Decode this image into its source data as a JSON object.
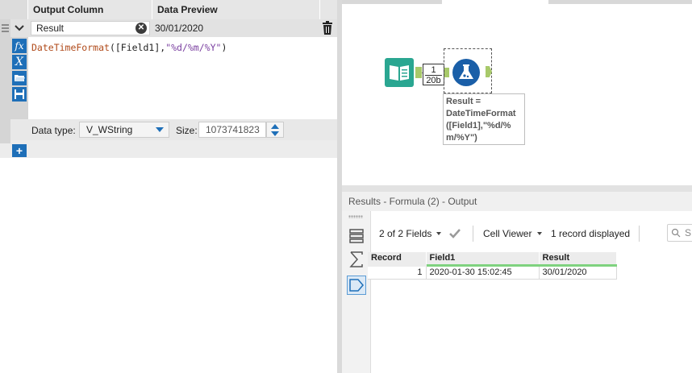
{
  "formula_panel": {
    "header": {
      "col_output": "Output Column",
      "col_preview": "Data Preview"
    },
    "row": {
      "output_value": "Result",
      "preview_value": "30/01/2020",
      "expression_fn": "DateTimeFormat",
      "expression_open": "([Field1],",
      "expression_fmt": "\"%d/%m/%Y\"",
      "expression_close": ")"
    },
    "datatype_label": "Data type:",
    "datatype_value": "V_WString",
    "size_label": "Size:",
    "size_value": "1073741823",
    "add_label": "+",
    "clear_label": "✕"
  },
  "canvas": {
    "connection_label_top": "1",
    "connection_label_bottom": "20b",
    "annotation": "Result =\nDateTimeFormat\n([Field1],\"%d/%\nm/%Y\")"
  },
  "results": {
    "title": "Results - Formula (2) - Output",
    "fields_selector": "2 of 2 Fields",
    "cell_viewer": "Cell Viewer",
    "record_count": "1 record displayed",
    "search_placeholder": "S",
    "columns": [
      "Record",
      "Field1",
      "Result"
    ],
    "rows": [
      {
        "record": "1",
        "field1": "2020-01-30 15:02:45",
        "result": "30/01/2020"
      }
    ]
  },
  "colors": {
    "accent": "#1e6fb8",
    "tool_green": "#2aa691",
    "anchor": "#a8c96a",
    "header_underline": "#7fd27f"
  }
}
